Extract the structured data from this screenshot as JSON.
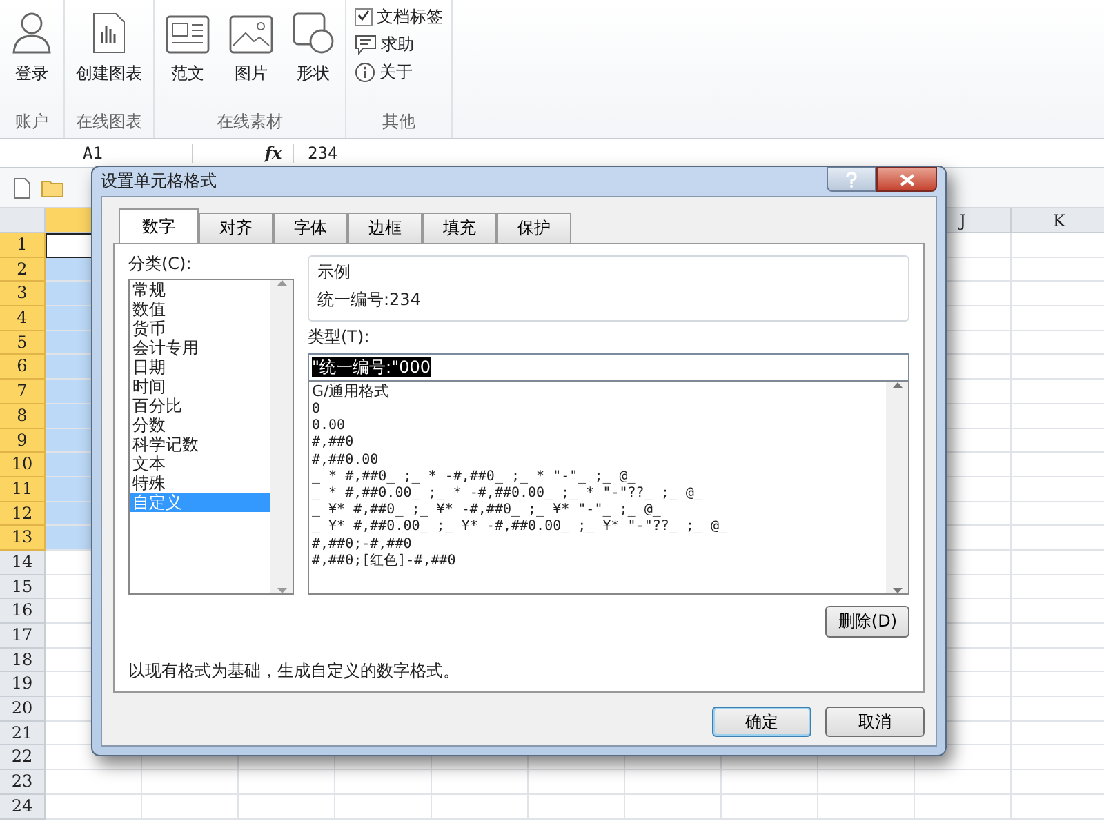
{
  "ribbon": {
    "groups": [
      {
        "label": "账户",
        "items": [
          {
            "kind": "big",
            "label": "登录"
          }
        ]
      },
      {
        "label": "在线图表",
        "items": [
          {
            "kind": "big",
            "label": "创建图表"
          }
        ]
      },
      {
        "label": "在线素材",
        "items": [
          {
            "kind": "big",
            "label": "范文"
          },
          {
            "kind": "big",
            "label": "图片"
          },
          {
            "kind": "big",
            "label": "形状"
          }
        ]
      },
      {
        "label": "其他",
        "items": [
          {
            "kind": "check",
            "label": "文档标签",
            "checked": true
          },
          {
            "kind": "small",
            "label": "求助"
          },
          {
            "kind": "small",
            "label": "关于"
          }
        ]
      }
    ]
  },
  "formula_bar": {
    "name_box": "A1",
    "function_label": "fx",
    "value": "234"
  },
  "sheet": {
    "columns": [
      "J",
      "K"
    ],
    "rows": [
      {
        "label": "1",
        "selected": true,
        "active": true
      },
      {
        "label": "2",
        "selected": true,
        "active": false
      },
      {
        "label": "3",
        "selected": true,
        "active": false
      },
      {
        "label": "4",
        "selected": true,
        "active": false
      },
      {
        "label": "5",
        "selected": true,
        "active": false
      },
      {
        "label": "6",
        "selected": true,
        "active": false
      },
      {
        "label": "7",
        "selected": true,
        "active": false
      },
      {
        "label": "8",
        "selected": true,
        "active": false
      },
      {
        "label": "9",
        "selected": true,
        "active": false
      },
      {
        "label": "10",
        "selected": true,
        "active": false
      },
      {
        "label": "11",
        "selected": true,
        "active": false
      },
      {
        "label": "12",
        "selected": true,
        "active": false
      },
      {
        "label": "13",
        "selected": true,
        "active": false
      },
      {
        "label": "14",
        "selected": false,
        "active": false
      },
      {
        "label": "15",
        "selected": false,
        "active": false
      },
      {
        "label": "16",
        "selected": false,
        "active": false
      },
      {
        "label": "17",
        "selected": false,
        "active": false
      },
      {
        "label": "18",
        "selected": false,
        "active": false
      },
      {
        "label": "19",
        "selected": false,
        "active": false
      },
      {
        "label": "20",
        "selected": false,
        "active": false
      },
      {
        "label": "21",
        "selected": false,
        "active": false
      },
      {
        "label": "22",
        "selected": false,
        "active": false
      },
      {
        "label": "23",
        "selected": false,
        "active": false
      },
      {
        "label": "24",
        "selected": false,
        "active": false
      }
    ]
  },
  "dialog": {
    "title": "设置单元格格式",
    "tabs": [
      {
        "label": "数字",
        "selected": true
      },
      {
        "label": "对齐",
        "selected": false
      },
      {
        "label": "字体",
        "selected": false
      },
      {
        "label": "边框",
        "selected": false
      },
      {
        "label": "填充",
        "selected": false
      },
      {
        "label": "保护",
        "selected": false
      }
    ],
    "category_label": "分类(C):",
    "categories": [
      {
        "label": "常规",
        "selected": false
      },
      {
        "label": "数值",
        "selected": false
      },
      {
        "label": "货币",
        "selected": false
      },
      {
        "label": "会计专用",
        "selected": false
      },
      {
        "label": "日期",
        "selected": false
      },
      {
        "label": "时间",
        "selected": false
      },
      {
        "label": "百分比",
        "selected": false
      },
      {
        "label": "分数",
        "selected": false
      },
      {
        "label": "科学记数",
        "selected": false
      },
      {
        "label": "文本",
        "selected": false
      },
      {
        "label": "特殊",
        "selected": false
      },
      {
        "label": "自定义",
        "selected": true
      }
    ],
    "sample": {
      "label": "示例",
      "value": "统一编号:234"
    },
    "type_label": "类型(T):",
    "type_value": "\"统一编号:\"000",
    "type_list": [
      "G/通用格式",
      "0",
      "0.00",
      "#,##0",
      "#,##0.00",
      "_ * #,##0_ ;_ * -#,##0_ ;_ * \"-\"_ ;_ @_",
      "_ * #,##0.00_ ;_ * -#,##0.00_ ;_ * \"-\"??_ ;_ @_",
      "_ ¥* #,##0_ ;_ ¥* -#,##0_ ;_ ¥* \"-\"_ ;_ @_",
      "_ ¥* #,##0.00_ ;_ ¥* -#,##0.00_ ;_ ¥* \"-\"??_ ;_ @_",
      "#,##0;-#,##0",
      "#,##0;[红色]-#,##0"
    ],
    "delete_button": "删除(D)",
    "description": "以现有格式为基础，生成自定义的数字格式。",
    "ok_button": "确定",
    "cancel_button": "取消"
  }
}
